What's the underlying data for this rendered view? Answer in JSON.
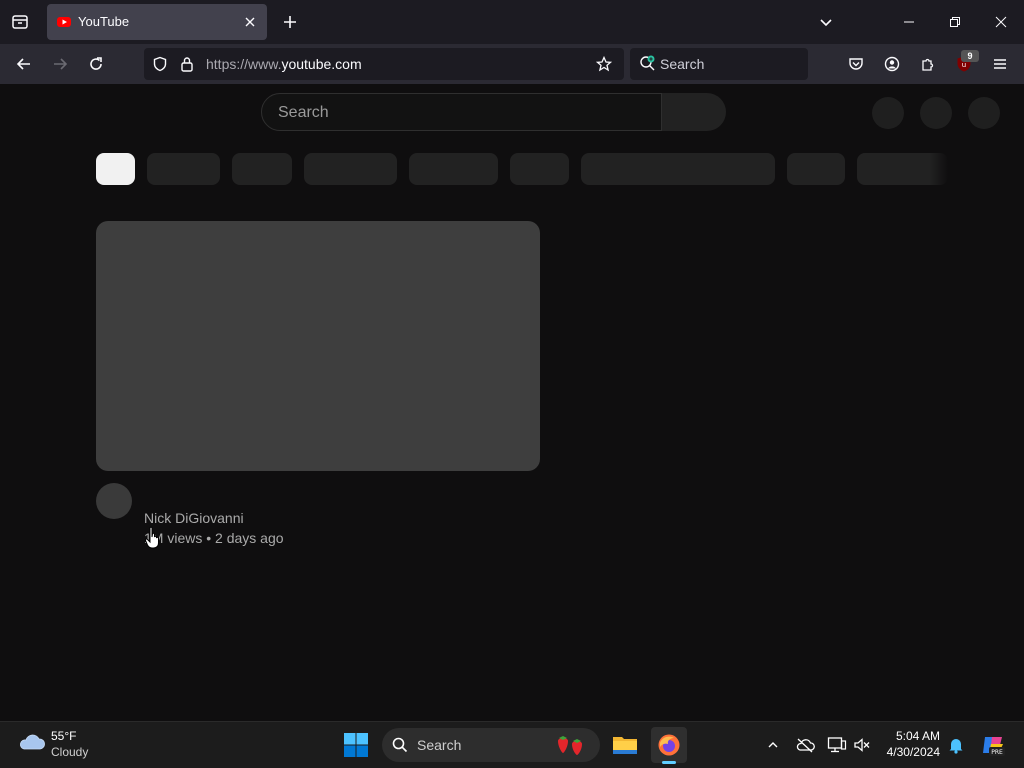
{
  "browser": {
    "tab": {
      "title": "YouTube"
    },
    "url": {
      "prefix": "https://www.",
      "domain": "youtube.com"
    },
    "search_placeholder": "Search",
    "extension_badge": "9"
  },
  "youtube": {
    "search_placeholder": "Search",
    "chip_count": 10,
    "video": {
      "channel": "Nick DiGiovanni",
      "meta": "1M views • 2 days ago"
    }
  },
  "taskbar": {
    "weather": {
      "temp": "55°F",
      "condition": "Cloudy"
    },
    "search_placeholder": "Search",
    "clock": {
      "time": "5:04 AM",
      "date": "4/30/2024"
    }
  },
  "colors": {
    "accent": "#60cdff",
    "youtube_red": "#ff0000",
    "ublock_red": "#800000"
  }
}
